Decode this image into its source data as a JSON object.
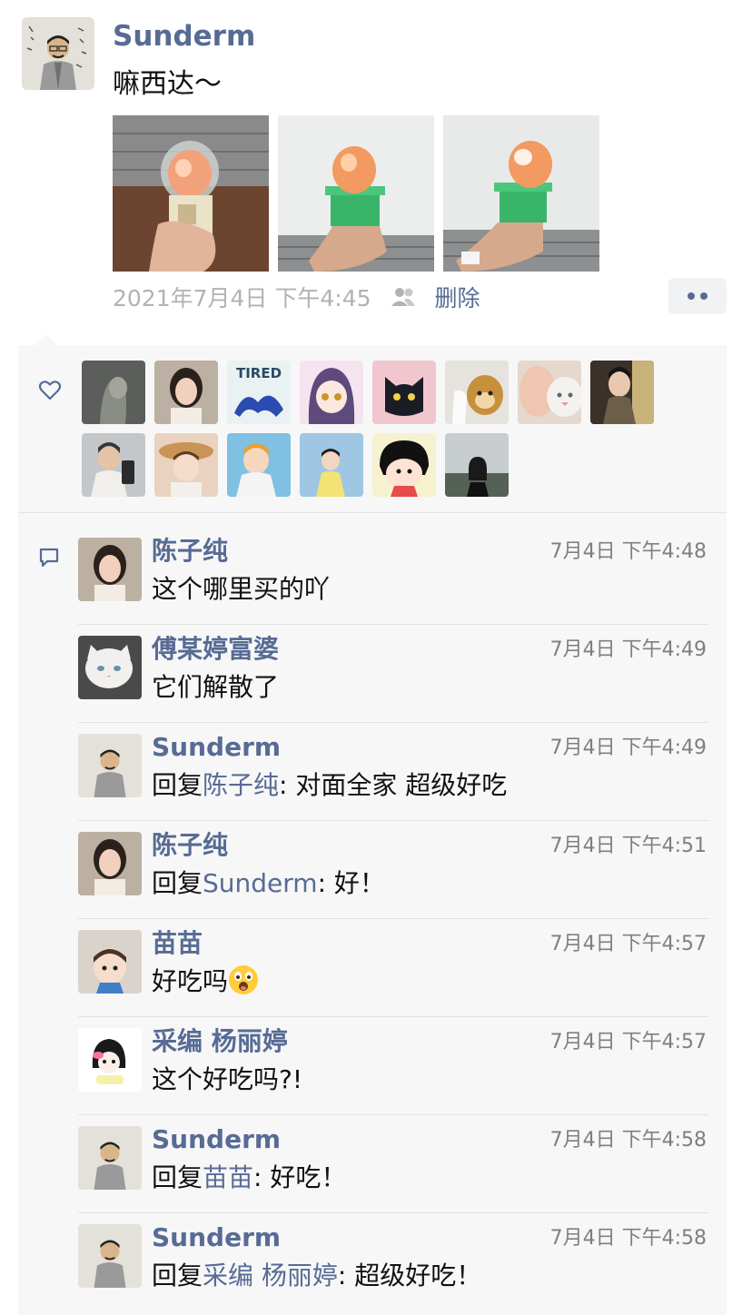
{
  "post": {
    "author": "Sunderm",
    "text": "嘛西达～",
    "timestamp": "2021年7月4日 下午4:45",
    "delete_label": "删除",
    "photos": [
      "peach-photo-1",
      "peach-photo-2",
      "peach-photo-3"
    ]
  },
  "icons": {
    "privacy": "people-icon",
    "like": "heart-outline-icon",
    "comment": "comment-bubble-icon",
    "more": "more-dots-icon"
  },
  "likes": {
    "avatars": [
      "avatar-1",
      "avatar-2",
      "avatar-3",
      "avatar-4",
      "avatar-5",
      "avatar-6",
      "avatar-7",
      "avatar-8",
      "avatar-9",
      "avatar-10",
      "avatar-11",
      "avatar-12",
      "avatar-13",
      "avatar-14"
    ],
    "avatar_3_text": "TIRED"
  },
  "colors": {
    "link": "#576b95",
    "panel_bg": "#f7f7f7",
    "meta_gray": "#b2b2b2"
  },
  "comments": [
    {
      "name": "陈子纯",
      "time": "7月4日 下午4:48",
      "text": "这个哪里买的吖"
    },
    {
      "name": "傅某婷富婆",
      "time": "7月4日 下午4:49",
      "text": "它们解散了"
    },
    {
      "name": "Sunderm",
      "time": "7月4日 下午4:49",
      "reply_prefix": "回复",
      "reply_to": "陈子纯",
      "text": ": 对面全家 超级好吃"
    },
    {
      "name": "陈子纯",
      "time": "7月4日 下午4:51",
      "reply_prefix": "回复",
      "reply_to": "Sunderm",
      "text": ": 好！"
    },
    {
      "name": "苗苗",
      "time": "7月4日 下午4:57",
      "text": "好吃吗",
      "emoji": "astonished-face-emoji"
    },
    {
      "name": "采编 杨丽婷",
      "time": "7月4日 下午4:57",
      "text": "这个好吃吗?!"
    },
    {
      "name": "Sunderm",
      "time": "7月4日 下午4:58",
      "reply_prefix": "回复",
      "reply_to": "苗苗",
      "text": ": 好吃！"
    },
    {
      "name": "Sunderm",
      "time": "7月4日 下午4:58",
      "reply_prefix": "回复",
      "reply_to": "采编 杨丽婷",
      "text": ": 超级好吃！"
    }
  ]
}
